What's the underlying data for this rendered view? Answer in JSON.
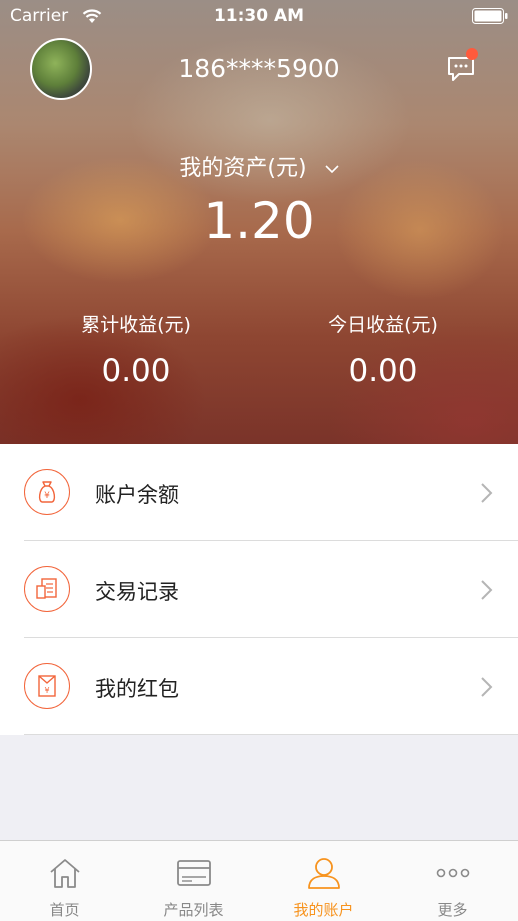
{
  "status_bar": {
    "carrier": "Carrier",
    "time": "11:30 AM"
  },
  "header": {
    "phone": "186****5900",
    "has_unread_message": true
  },
  "assets": {
    "label": "我的资产(元)",
    "value": "1.20"
  },
  "stats": [
    {
      "label": "累计收益(元)",
      "value": "0.00"
    },
    {
      "label": "今日收益(元)",
      "value": "0.00"
    }
  ],
  "menu": [
    {
      "label": "账户余额",
      "icon": "money-bag-icon"
    },
    {
      "label": "交易记录",
      "icon": "transaction-record-icon"
    },
    {
      "label": "我的红包",
      "icon": "red-envelope-icon"
    }
  ],
  "tabs": [
    {
      "label": "首页",
      "icon": "home-icon",
      "active": false
    },
    {
      "label": "产品列表",
      "icon": "card-icon",
      "active": false
    },
    {
      "label": "我的账户",
      "icon": "user-icon",
      "active": true
    },
    {
      "label": "更多",
      "icon": "more-icon",
      "active": false
    }
  ],
  "colors": {
    "accent": "#f2653b",
    "tab_active": "#f7931e",
    "badge": "#ff5a3c"
  }
}
